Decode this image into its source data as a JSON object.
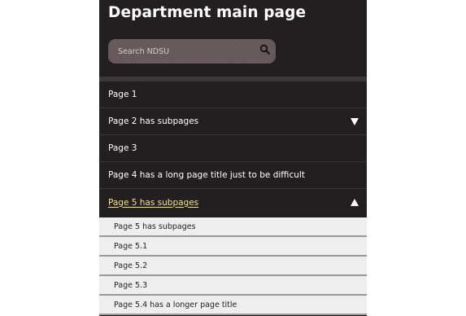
{
  "header": {
    "title": "Department main page",
    "search_placeholder": "Search NDSU"
  },
  "nav": {
    "items": [
      {
        "label": "Page 1"
      },
      {
        "label": "Page 2 has subpages",
        "toggle": "expand"
      },
      {
        "label": "Page 3"
      },
      {
        "label": "Page 4 has a long page title just to be difficult"
      },
      {
        "label": "Page 5 has subpages",
        "toggle": "collapse",
        "active": true
      }
    ],
    "subpages": [
      {
        "label": "Page 5 has subpages"
      },
      {
        "label": "Page 5.1"
      },
      {
        "label": "Page 5.2"
      },
      {
        "label": "Page 5.3"
      },
      {
        "label": "Page 5.4 has a longer page title"
      }
    ]
  },
  "icons": {
    "search": "search-icon",
    "expand": "triangle-down-icon",
    "collapse": "triangle-up-icon"
  },
  "colors": {
    "panel": "#231f20",
    "active_link": "#f7e48a",
    "submenu_bg": "#eeeeee"
  }
}
